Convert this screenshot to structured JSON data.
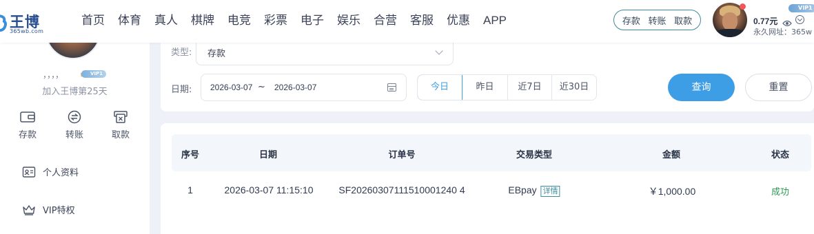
{
  "header": {
    "logo_text": "王博",
    "logo_url": "365wb.com",
    "nav": [
      "首页",
      "体育",
      "真人",
      "棋牌",
      "电竞",
      "彩票",
      "电子",
      "娱乐",
      "合营",
      "客服",
      "优惠",
      "APP"
    ],
    "quick_actions": [
      "存款",
      "转账",
      "取款"
    ],
    "balance": "0.77元",
    "vip_badge": "VIP1",
    "permanent_url": "永久网址：365w"
  },
  "sidebar": {
    "username": "，，，，",
    "vip_badge": "VIP1",
    "join_days": "加入王博第25天",
    "wallet_actions": [
      "存款",
      "转账",
      "取款"
    ],
    "menu": [
      "个人资料",
      "VIP特权"
    ]
  },
  "filter": {
    "type_label": "类型:",
    "type_value": "存款",
    "date_label": "日期:",
    "date_start": "2026-03-07",
    "date_separator": "~",
    "date_end": "2026-03-07",
    "quick_dates": [
      "今日",
      "昨日",
      "近7日",
      "近30日"
    ],
    "active_quick_date": "今日",
    "query_label": "查询",
    "reset_label": "重置"
  },
  "table": {
    "headers": [
      "序号",
      "日期",
      "订单号",
      "交易类型",
      "金额",
      "状态"
    ],
    "rows": [
      {
        "index": "1",
        "date": "2026-03-07 11:15:10",
        "order_no": "SF20260307111510001240 4",
        "type": "EBpay",
        "detail": "详情",
        "amount": "￥1,000.00",
        "status": "成功"
      }
    ]
  },
  "colors": {
    "accent": "#3d9ee6",
    "success": "#2c9b55",
    "nav_text": "#3b4257",
    "vip": "#7cb2de"
  }
}
